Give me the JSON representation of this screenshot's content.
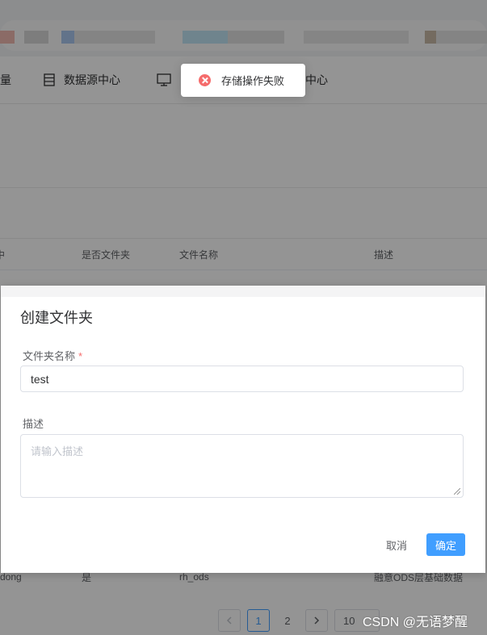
{
  "nav": {
    "items": [
      {
        "label": "量",
        "icon": "truncated"
      },
      {
        "label": "数据源中心",
        "icon": "server-icon"
      },
      {
        "label": "",
        "icon": "monitor-icon"
      },
      {
        "label": "中心",
        "icon": "none"
      }
    ]
  },
  "table": {
    "headers": [
      "中",
      "是否文件夹",
      "文件名称",
      "描述"
    ],
    "last_row": [
      "dong",
      "是",
      "rh_ods",
      "融意ODS层基础数据"
    ]
  },
  "pagination": {
    "pages": [
      "1",
      "2"
    ],
    "current": "1",
    "size_label": "10"
  },
  "toast": {
    "message": "存储操作失败",
    "type": "error",
    "color": "#f56c6c"
  },
  "dialog": {
    "title": "创建文件夹",
    "name_label": "文件夹名称",
    "required_mark": "*",
    "name_value": "test",
    "desc_label": "描述",
    "desc_placeholder": "请输入描述",
    "cancel_label": "取消",
    "confirm_label": "确定",
    "accent": "#409eff"
  },
  "watermark": "CSDN @无语梦醒"
}
